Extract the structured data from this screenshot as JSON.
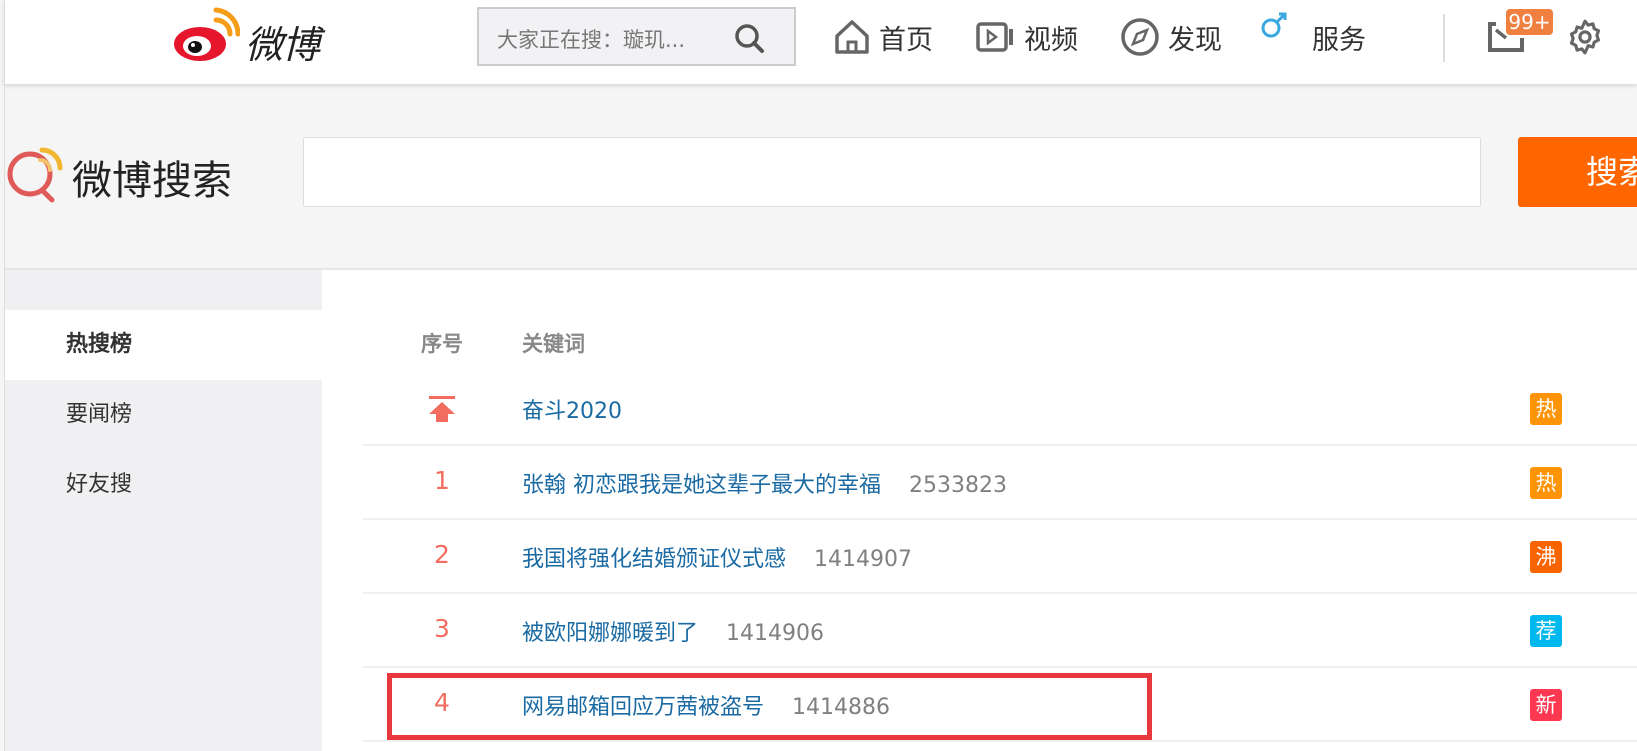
{
  "topnav": {
    "logo_text": "微博",
    "search_placeholder": "大家正在搜：璇玑...",
    "nav": [
      {
        "label": "首页",
        "icon": "home-icon"
      },
      {
        "label": "视频",
        "icon": "video-icon"
      },
      {
        "label": "发现",
        "icon": "compass-icon"
      },
      {
        "label": "服务",
        "icon": "male-icon"
      }
    ],
    "mail_badge": "99+"
  },
  "search": {
    "title": "微博搜索",
    "button": "搜索",
    "value": ""
  },
  "sidebar": {
    "items": [
      {
        "label": "热搜榜"
      },
      {
        "label": "要闻榜"
      },
      {
        "label": "好友搜"
      }
    ]
  },
  "table": {
    "headers": {
      "rank": "序号",
      "keyword": "关键词"
    },
    "rows": [
      {
        "rank": "",
        "pinned": true,
        "keyword": "奋斗2020",
        "count": "",
        "tag": "热",
        "tag_color": "#ff9406"
      },
      {
        "rank": "1",
        "keyword": "张翰 初恋跟我是她这辈子最大的幸福",
        "count": "2533823",
        "tag": "热",
        "tag_color": "#ff9406"
      },
      {
        "rank": "2",
        "keyword": "我国将强化结婚颁证仪式感",
        "count": "1414907",
        "tag": "沸",
        "tag_color": "#f86400"
      },
      {
        "rank": "3",
        "keyword": "被欧阳娜娜暖到了",
        "count": "1414906",
        "tag": "荐",
        "tag_color": "#00b7ee"
      },
      {
        "rank": "4",
        "keyword": "网易邮箱回应万茜被盗号",
        "count": "1414886",
        "tag": "新",
        "tag_color": "#ff3852"
      }
    ]
  },
  "colors": {
    "accent": "#ff6600",
    "highlight": "#e8383d",
    "keyword": "#1a6aa3",
    "rank": "#f26d5f"
  }
}
